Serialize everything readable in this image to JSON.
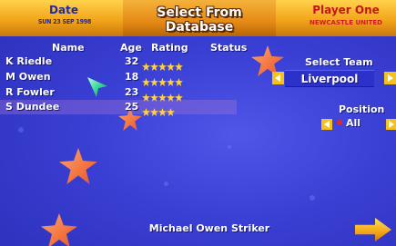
{
  "header": {
    "date_label": "Date",
    "date_value": "SUN 23 SEP 1998",
    "title": "Select From Database",
    "player_label": "Player One",
    "player_team": "NEWCASTLE UNITED"
  },
  "table": {
    "columns": [
      "Name",
      "Age",
      "Rating",
      "Status"
    ],
    "rows": [
      {
        "name": "K Riedle",
        "age": "32",
        "rating": 5,
        "status": ""
      },
      {
        "name": "M Owen",
        "age": "18",
        "rating": 5,
        "status": ""
      },
      {
        "name": "R Fowler",
        "age": "23",
        "rating": 5,
        "status": ""
      },
      {
        "name": "S Dundee",
        "age": "25",
        "rating": 4,
        "status": ""
      }
    ],
    "selected_row": 3
  },
  "team_selector": {
    "label": "Select Team",
    "value": "Liverpool"
  },
  "position_selector": {
    "label": "Position",
    "value": "All"
  },
  "footer": {
    "info": "Michael Owen Striker"
  },
  "colors": {
    "background": "#3a3fd4",
    "accent": "#f2a51a",
    "rating_star": "#ffd23a",
    "player_text": "#c4161a"
  },
  "icons": [
    "left-arrow-icon",
    "right-arrow-icon",
    "next-arrow-icon",
    "pointer-cursor-icon",
    "rating-star-icon",
    "decorative-star-icon"
  ]
}
